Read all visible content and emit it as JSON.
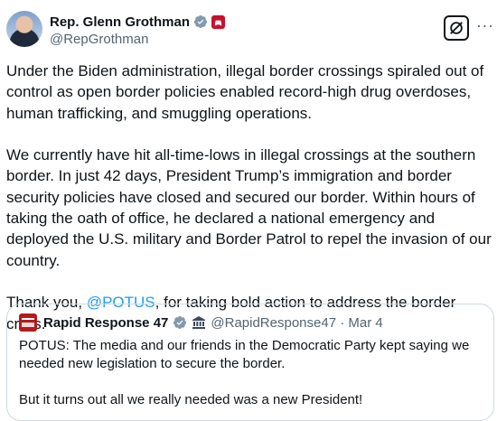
{
  "author": {
    "name": "Rep. Glenn Grothman",
    "handle": "@RepGrothman",
    "party_badge_color": "#c8102e"
  },
  "actions": {
    "grok_icon": "grok-icon",
    "more_label": "···"
  },
  "tweet": {
    "para1": "Under the Biden administration, illegal border crossings spiraled out of control as open border policies enabled record-high drug overdoses, human trafficking, and smuggling operations.",
    "para2": "We currently have hit all-time-lows in illegal crossings at the southern border. In just 42 days, President Trump’s immigration and border security policies have closed and secured our border. Within hours of taking the oath of office, he declared a national emergency and deployed the U.S. military and Border Patrol to repel the invasion of our country.",
    "para3_prefix": "Thank you, ",
    "para3_mention": "@POTUS",
    "para3_suffix": ", for taking bold action to address the border crisis."
  },
  "quoted": {
    "name": "Rapid Response 47",
    "handle_date": "@RapidResponse47 · Mar 4",
    "text": "POTUS: The media and our friends in the Democratic Party kept saying we needed new legislation to secure the border.\n\nBut it turns out all we really needed was a new President!"
  },
  "colors": {
    "link": "#1d9bf0",
    "verified_blue": "#1d9bf0",
    "secondary_text": "#536471"
  }
}
